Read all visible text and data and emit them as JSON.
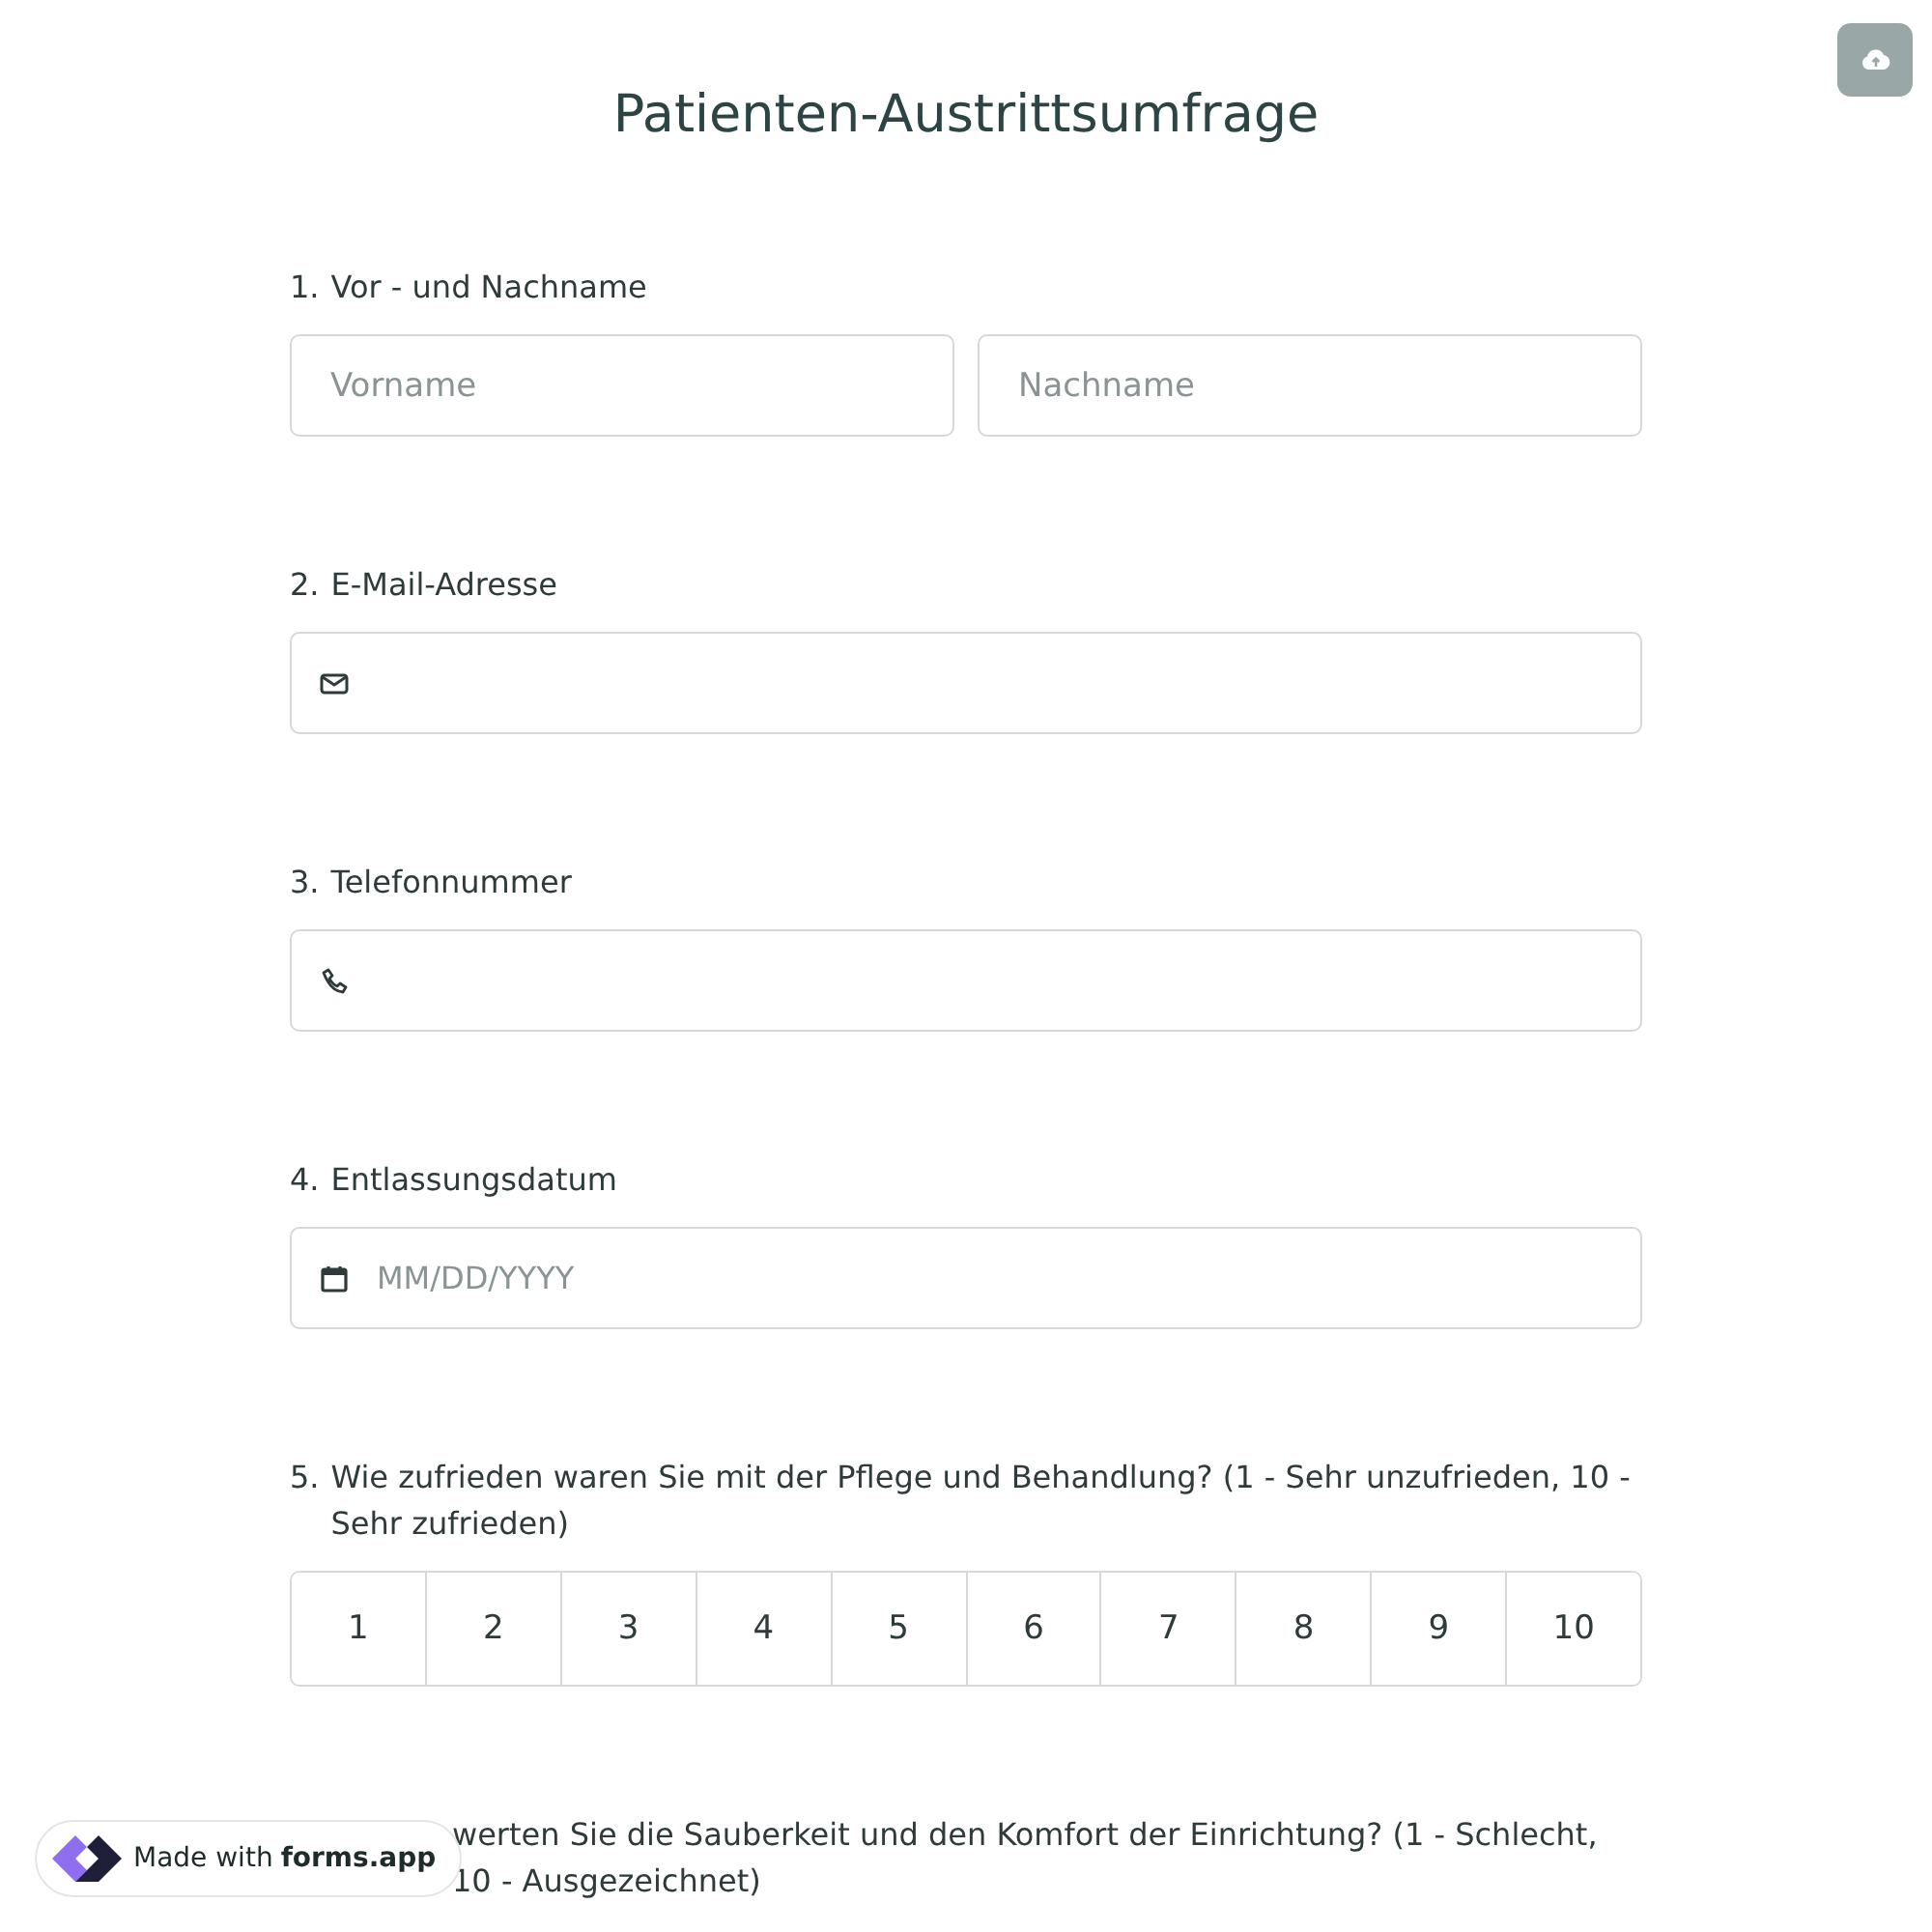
{
  "title": "Patienten-Austrittsumfrage",
  "questions": [
    {
      "kind": "name",
      "number": "1.",
      "label": "Vor - und Nachname",
      "fields": [
        {
          "placeholder": "Vorname"
        },
        {
          "placeholder": "Nachname"
        }
      ]
    },
    {
      "kind": "email",
      "number": "2.",
      "label": "E-Mail-Adresse"
    },
    {
      "kind": "phone",
      "number": "3.",
      "label": "Telefonnummer"
    },
    {
      "kind": "date",
      "number": "4.",
      "label": "Entlassungsdatum",
      "placeholder": "MM/DD/YYYY"
    },
    {
      "kind": "scale",
      "number": "5.",
      "label": "Wie zufrieden waren Sie mit der Pflege und Behandlung? (1 - Sehr unzufrieden, 10 - Sehr zufrieden)",
      "options": [
        {
          "label": "1",
          "selected": false
        },
        {
          "label": "2",
          "selected": false
        },
        {
          "label": "3",
          "selected": false
        },
        {
          "label": "4",
          "selected": false
        },
        {
          "label": "5",
          "selected": false
        },
        {
          "label": "6",
          "selected": false
        },
        {
          "label": "7",
          "selected": false
        },
        {
          "label": "8",
          "selected": false
        },
        {
          "label": "9",
          "selected": false
        },
        {
          "label": "10",
          "selected": false
        }
      ]
    },
    {
      "kind": "covered",
      "label": "werten Sie die Sauberkeit und den Komfort der Einrichtung? (1 - Schlecht, 10 - Ausgezeichnet)"
    }
  ],
  "badge": {
    "prefix": "Made with",
    "brand": "forms.app"
  }
}
